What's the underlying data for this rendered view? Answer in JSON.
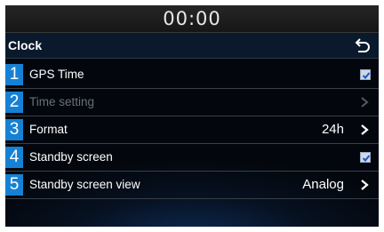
{
  "status_bar": {
    "time": "00:00"
  },
  "header": {
    "title": "Clock",
    "back_icon": "back-arrow-icon"
  },
  "items": [
    {
      "number": "1",
      "label": "GPS Time",
      "control": "checkbox",
      "checked": true,
      "enabled": true
    },
    {
      "number": "2",
      "label": "Time setting",
      "control": "chevron",
      "enabled": false
    },
    {
      "number": "3",
      "label": "Format",
      "value": "24h",
      "control": "chevron",
      "enabled": true
    },
    {
      "number": "4",
      "label": "Standby screen",
      "control": "checkbox",
      "checked": true,
      "enabled": true
    },
    {
      "number": "5",
      "label": "Standby screen view",
      "value": "Analog",
      "control": "chevron",
      "enabled": true
    }
  ],
  "colors": {
    "accent": "#1681d4",
    "checkbox_check": "#1a56c8",
    "disabled_text": "#6a6f76"
  }
}
